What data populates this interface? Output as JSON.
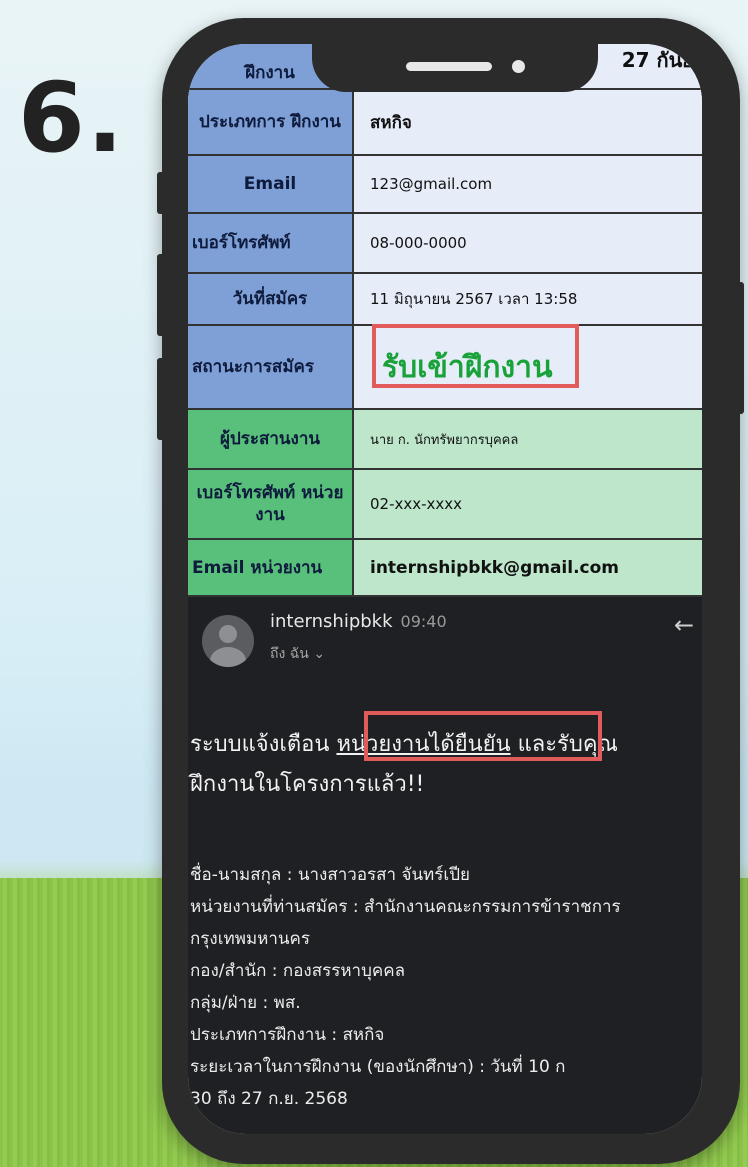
{
  "step_number": "6.",
  "top_partial": {
    "label": "ฝึกงาน",
    "value": "27 กันย"
  },
  "table": {
    "type_label": "ประเภทการ ฝึกงาน",
    "type_value": "สหกิจ",
    "email_label": "Email",
    "email_value": "123@gmail.com",
    "phone_label": "เบอร์โทรศัพท์",
    "phone_value": "08-000-0000",
    "apply_date_label": "วันที่สมัคร",
    "apply_date_value": "11 มิถุนายน 2567 เวลา 13:58",
    "status_label": "สถานะการสมัคร",
    "status_value": "รับเข้าฝึกงาน",
    "coordinator_label": "ผู้ประสานงาน",
    "coordinator_value": "นาย ก. นักทรัพยากรบุคคล",
    "unit_phone_label": "เบอร์โทรศัพท์ หน่วยงาน",
    "unit_phone_value": "02-xxx-xxxx",
    "unit_email_label": "Email หน่วยงาน",
    "unit_email_value": "internshipbkk@gmail.com"
  },
  "email": {
    "sender": "internshipbkk",
    "time": "09:40",
    "to": "ถึง ฉัน ⌄",
    "headline_pre": "ระบบแจ้งเตือน ",
    "headline_highlight": "หน่วยงานได้ยืนยัน",
    "headline_post": " และรับคุณ",
    "headline_line2": "ฝึกงานในโครงการแล้ว!!",
    "details": [
      "ชื่อ-นามสกุล : นางสาวอรสา จันทร์เปีย",
      "หน่วยงานที่ท่านสมัคร : สำนักงานคณะกรรมการข้าราชการ",
      "กรุงเทพมหานคร",
      "กอง/สำนัก : กองสรรหาบุคคล",
      "กลุ่ม/ฝ่าย : พส.",
      "ประเภทการฝึกงาน : สหกิจ",
      "ระยะเวลาในการฝึกงาน (ของนักศึกษา) : วันที่ 10 ก",
      "30 ถึง 27 ก.ย. 2568"
    ]
  },
  "colors": {
    "blue_label": "#7fa0d6",
    "green_label": "#58c07a",
    "status_green": "#1aa23a",
    "highlight_red": "#e15b5b",
    "email_bg": "#1f2023"
  }
}
